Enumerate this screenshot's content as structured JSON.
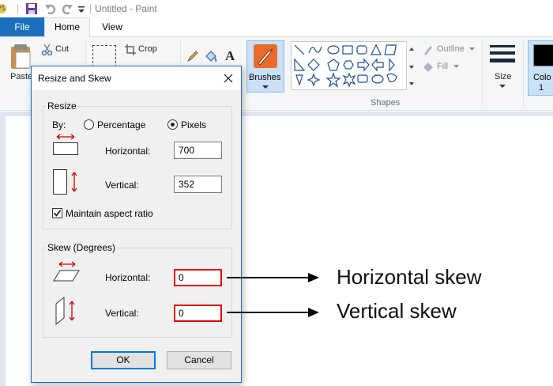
{
  "window": {
    "title": "Untitled - Paint"
  },
  "tabs": [
    {
      "label": "File"
    },
    {
      "label": "Home"
    },
    {
      "label": "View"
    }
  ],
  "ribbon": {
    "paste_label": "Paste",
    "clipboard": {
      "cut_label": "Cut"
    },
    "image": {
      "crop_label": "Crop"
    },
    "brushes_label": "Brushes",
    "shapes": {
      "outline_label": "Outline",
      "fill_label": "Fill",
      "group_label": "Shapes"
    },
    "size_label": "Size",
    "color1_label_line1": "Colo",
    "color1_label_line2": "1"
  },
  "dialog": {
    "title": "Resize and Skew",
    "resize": {
      "legend": "Resize",
      "by_label": "By:",
      "percentage_label": "Percentage",
      "pixels_label": "Pixels",
      "selected_unit": "Pixels",
      "horizontal_label": "Horizontal:",
      "horizontal_value": "700",
      "vertical_label": "Vertical:",
      "vertical_value": "352",
      "maintain_aspect_label": "Maintain aspect ratio",
      "maintain_aspect_checked": true
    },
    "skew": {
      "legend": "Skew (Degrees)",
      "horizontal_label": "Horizontal:",
      "horizontal_value": "0",
      "vertical_label": "Vertical:",
      "vertical_value": "0"
    },
    "ok_label": "OK",
    "cancel_label": "Cancel"
  },
  "annotations": {
    "horizontal_skew": "Horizontal skew",
    "vertical_skew": "Vertical skew"
  },
  "colors": {
    "accent": "#1c6fbf",
    "highlight": "#e00000",
    "arrow": "#d00000"
  }
}
